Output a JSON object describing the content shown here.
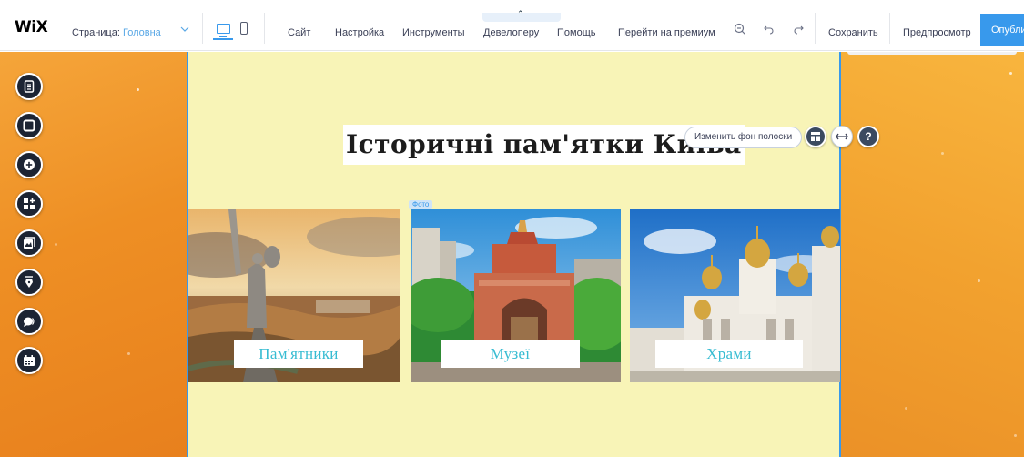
{
  "topbar": {
    "logo": "WiX",
    "page_label": "Страница:",
    "page_name": "Головна",
    "menu": {
      "site": "Сайт",
      "settings": "Настройка",
      "tools": "Инструменты",
      "developer": "Девелоперу",
      "help": "Помощь",
      "premium": "Перейти на премиум"
    },
    "save": "Сохранить",
    "preview": "Предпросмотр",
    "publish": "Опубликовать"
  },
  "canvas": {
    "title": "Історичні пам'ятки Київа",
    "change_bg": "Изменить фон полоски",
    "photo_tag": "Фото",
    "galleries": [
      {
        "label": "Пам'ятники"
      },
      {
        "label": "Музеї"
      },
      {
        "label": "Храми"
      }
    ]
  },
  "colors": {
    "accent": "#3899ec",
    "content_bg": "#f8f4b7",
    "side_bg": "#ee8f24",
    "label_text": "#37bcd2"
  },
  "left_tools": [
    "pages-icon",
    "background-icon",
    "add-icon",
    "add-apps-icon",
    "media-icon",
    "blog-icon",
    "chat-icon",
    "bookings-icon"
  ]
}
